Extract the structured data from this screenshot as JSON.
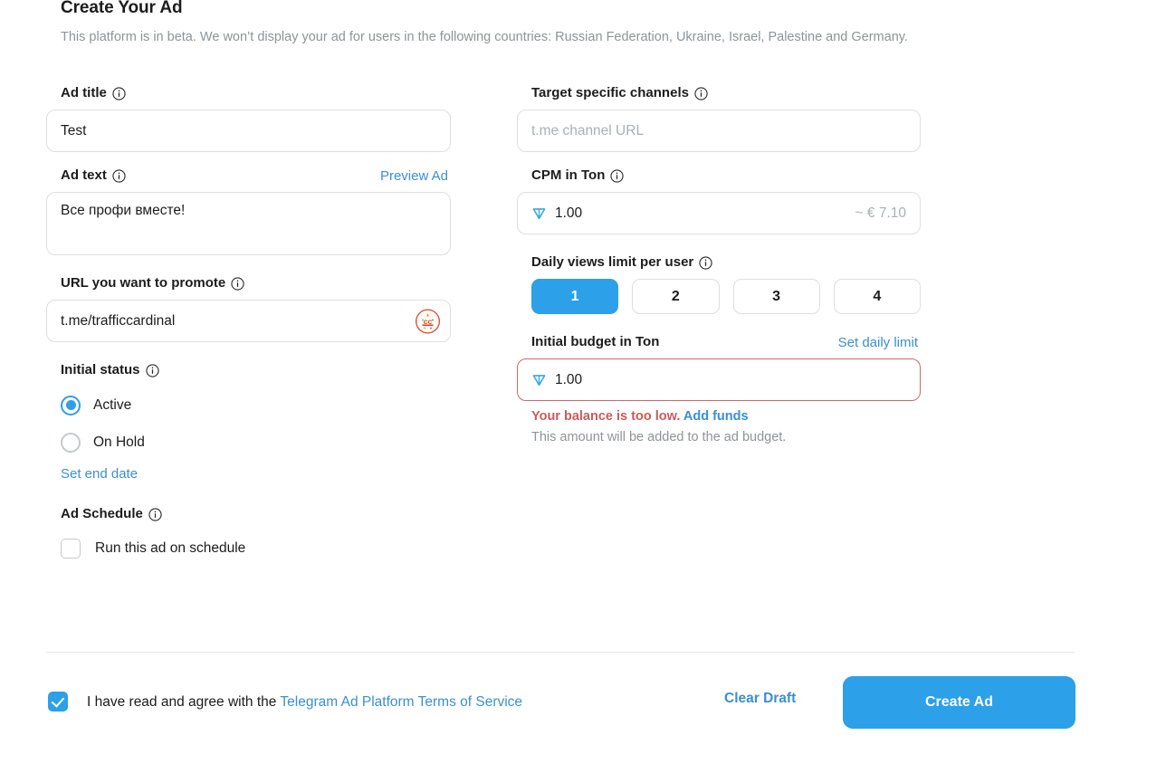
{
  "header": {
    "title": "Create Your Ad",
    "beta_note": "This platform is in beta. We won’t display your ad for users in the following countries: Russian Federation, Ukraine, Israel, Palestine and Germany."
  },
  "left_column": {
    "ad_title": {
      "label": "Ad title",
      "value": "Test",
      "placeholder": ""
    },
    "ad_text": {
      "label": "Ad text",
      "preview_link": "Preview Ad",
      "value": "Все профи вместе!",
      "placeholder": ""
    },
    "url": {
      "label": "URL you want to promote",
      "value": "t.me/trafficcardinal",
      "placeholder": "",
      "avatar_name": "channel-avatar"
    },
    "initial_status": {
      "label": "Initial status",
      "options": [
        {
          "label": "Active",
          "selected": true
        },
        {
          "label": "On Hold",
          "selected": false
        }
      ],
      "set_end_date_link": "Set end date"
    },
    "ad_schedule": {
      "label": "Ad Schedule",
      "checkbox_label": "Run this ad on schedule",
      "checked": false
    }
  },
  "right_column": {
    "target_channels": {
      "label": "Target specific channels",
      "value": "",
      "placeholder": "t.me channel URL"
    },
    "cpm": {
      "label": "CPM in Ton",
      "value": "1.00",
      "converted": "~ € 7.10",
      "currency_icon": "ton-icon"
    },
    "daily_views": {
      "label": "Daily views limit per user",
      "options": [
        "1",
        "2",
        "3",
        "4"
      ],
      "selected": "1"
    },
    "initial_budget": {
      "label": "Initial budget in Ton",
      "set_daily_limit_link": "Set daily limit",
      "value": "1.00",
      "currency_icon": "ton-icon",
      "has_error": true,
      "error_text": "Your balance is too low.",
      "error_link": "Add funds",
      "hint_text": "This amount will be added to the ad budget."
    }
  },
  "footer": {
    "agree_prefix": "I have read and agree with the ",
    "agree_link": "Telegram Ad Platform Terms of Service",
    "agree_checked": true,
    "clear_draft": "Clear Draft",
    "create_ad": "Create Ad"
  },
  "colors": {
    "accent": "#2ca0e8",
    "link": "#3a8fd4",
    "error": "#cc5b5b",
    "error_border": "#c96a6a",
    "muted": "#8d9499",
    "border": "#dcdfe1",
    "text": "#1c1c1e"
  }
}
